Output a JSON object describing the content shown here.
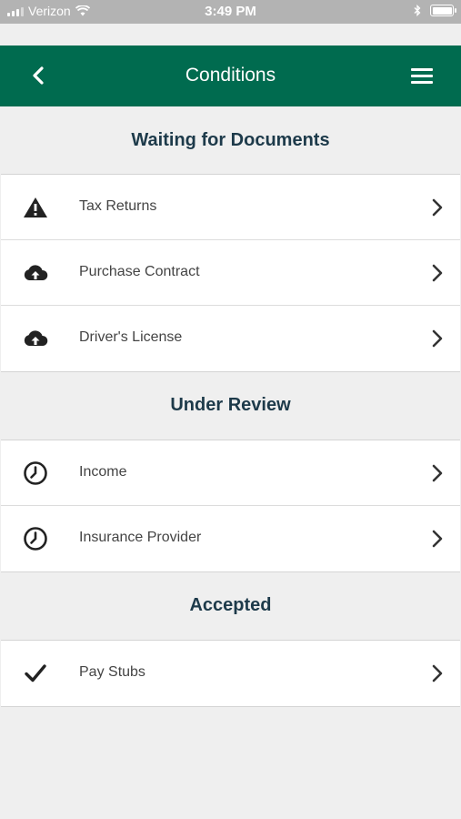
{
  "status_bar": {
    "carrier": "Verizon",
    "time": "3:49 PM"
  },
  "header": {
    "title": "Conditions"
  },
  "sections": [
    {
      "heading": "Waiting for Documents",
      "items": [
        {
          "label": "Tax Returns",
          "icon": "warning-icon"
        },
        {
          "label": "Purchase Contract",
          "icon": "cloud-upload-icon"
        },
        {
          "label": "Driver's License",
          "icon": "cloud-upload-icon"
        }
      ]
    },
    {
      "heading": "Under Review",
      "items": [
        {
          "label": "Income",
          "icon": "clock-icon"
        },
        {
          "label": "Insurance Provider",
          "icon": "clock-icon"
        }
      ]
    },
    {
      "heading": "Accepted",
      "items": [
        {
          "label": "Pay Stubs",
          "icon": "checkmark-icon"
        }
      ]
    }
  ],
  "colors": {
    "header_bg": "#006b4f",
    "heading_text": "#1d3a4a",
    "page_bg": "#efefef"
  }
}
